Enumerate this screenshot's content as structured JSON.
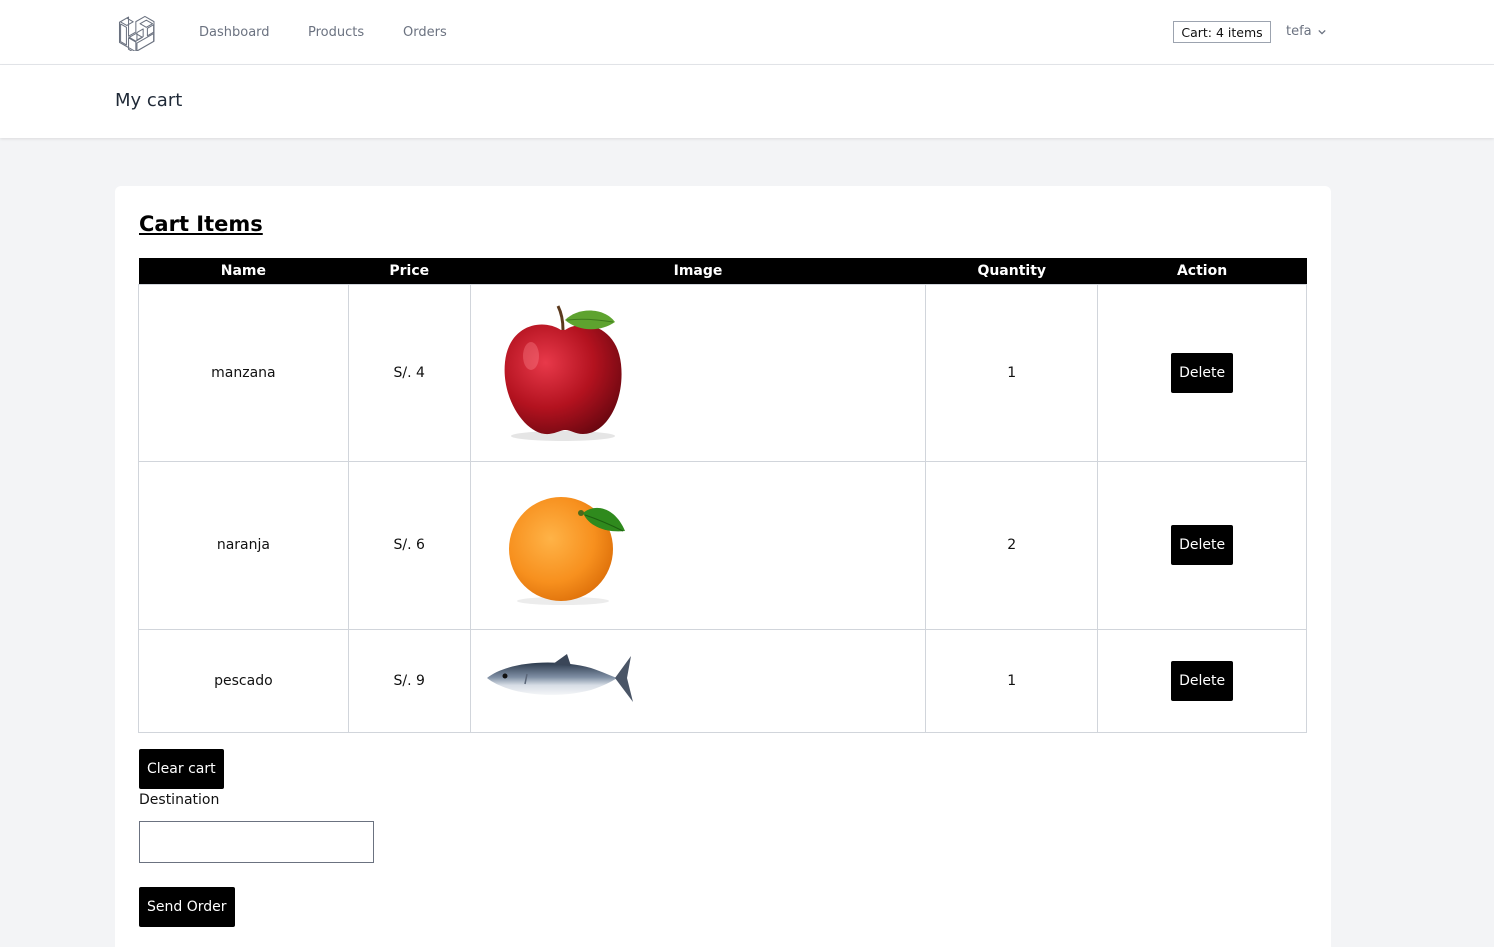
{
  "nav": {
    "links": [
      "Dashboard",
      "Products",
      "Orders"
    ],
    "cart_label": "Cart: 4 items",
    "user": "tefa"
  },
  "header": {
    "title": "My cart"
  },
  "cart": {
    "heading": "Cart Items",
    "columns": [
      "Name",
      "Price",
      "Image",
      "Quantity",
      "Action"
    ],
    "rows": [
      {
        "name": "manzana",
        "price": "S/. 4",
        "image": "apple-image",
        "quantity": "1",
        "action": "Delete"
      },
      {
        "name": "naranja",
        "price": "S/. 6",
        "image": "orange-image",
        "quantity": "2",
        "action": "Delete"
      },
      {
        "name": "pescado",
        "price": "S/. 9",
        "image": "fish-image",
        "quantity": "1",
        "action": "Delete"
      }
    ],
    "clear_label": "Clear cart",
    "destination_label": "Destination",
    "destination_value": "",
    "send_label": "Send Order"
  },
  "colors": {
    "accent": "#000000",
    "page_bg": "#f3f4f6",
    "logo": "#6b7280"
  }
}
